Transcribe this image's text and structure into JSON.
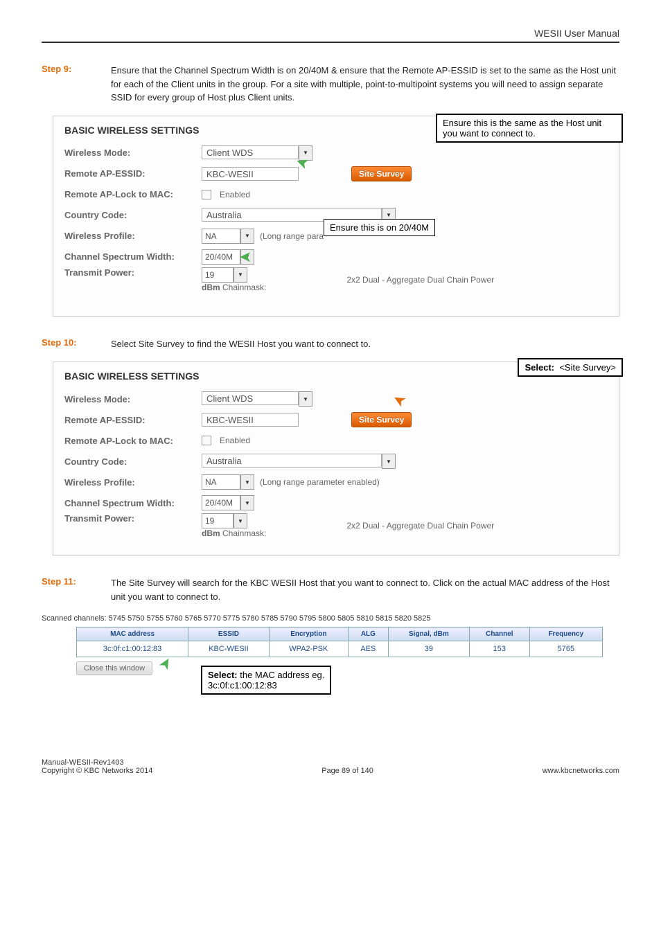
{
  "header": {
    "title": "WESII User Manual"
  },
  "step9": {
    "label": "Step 9:",
    "text": "Ensure that the Channel Spectrum Width is on 20/40M & ensure that the Remote AP-ESSID is set to the same as the Host unit for each of the Client units in the group. For a site with multiple, point-to-multipoint systems you will need to assign separate SSID for every group of Host plus Client units."
  },
  "panel1": {
    "title": "BASIC WIRELESS SETTINGS",
    "wirelessModeLabel": "Wireless Mode:",
    "wirelessModeValue": "Client WDS",
    "remoteEssidLabel": "Remote AP-ESSID:",
    "remoteEssidValue": "KBC-WESII",
    "siteSurveyBtn": "Site Survey",
    "lockMacLabel": "Remote AP-Lock to MAC:",
    "lockMacCheck": "Enabled",
    "countryLabel": "Country Code:",
    "countryValue": "Australia",
    "profileLabel": "Wireless Profile:",
    "profileValue": "NA",
    "profileNote": "(Long range parameter enabled)",
    "profileNoteShort": "(Long range para",
    "spectrumLabel": "Channel Spectrum Width:",
    "spectrumValue": "20/40M",
    "txLabel": "Transmit Power:",
    "txValue": "19",
    "dbmLabel": "dBm",
    "chainLabel": " Chainmask:",
    "chainNote": "2x2 Dual - Aggregate Dual Chain Power",
    "annoTop": "Ensure this is the same as the Host unit you want to connect to.",
    "annoMid": "Ensure this is on 20/40M"
  },
  "step10": {
    "label": "Step 10:",
    "text": "Select Site Survey to find the WESII Host you want to connect to."
  },
  "panel2": {
    "anno": "Select:  <Site Survey>",
    "annoBold": "Select:"
  },
  "step11": {
    "label": "Step 11:",
    "text": "The Site Survey will search for the KBC WESII Host that you want to connect to. Click on the actual MAC address of the Host unit you want to connect to."
  },
  "scan": {
    "channels": "Scanned channels: 5745 5750 5755 5760 5765 5770 5775 5780 5785 5790 5795 5800 5805 5810 5815 5820 5825",
    "headers": [
      "MAC address",
      "ESSID",
      "Encryption",
      "ALG",
      "Signal, dBm",
      "Channel",
      "Frequency"
    ],
    "row": [
      "3c:0f:c1:00:12:83",
      "KBC-WESII",
      "WPA2-PSK",
      "AES",
      "39",
      "153",
      "5765"
    ],
    "closeBtn": "Close this window",
    "anno1": "Select:",
    "anno2": "  the MAC address eg.",
    "anno3": "3c:0f:c1:00:12:83"
  },
  "footer": {
    "left1": "Manual-WESII-Rev1403",
    "left2": "Copyright © KBC Networks 2014",
    "mid": "Page 89 of 140",
    "right": "www.kbcnetworks.com"
  }
}
